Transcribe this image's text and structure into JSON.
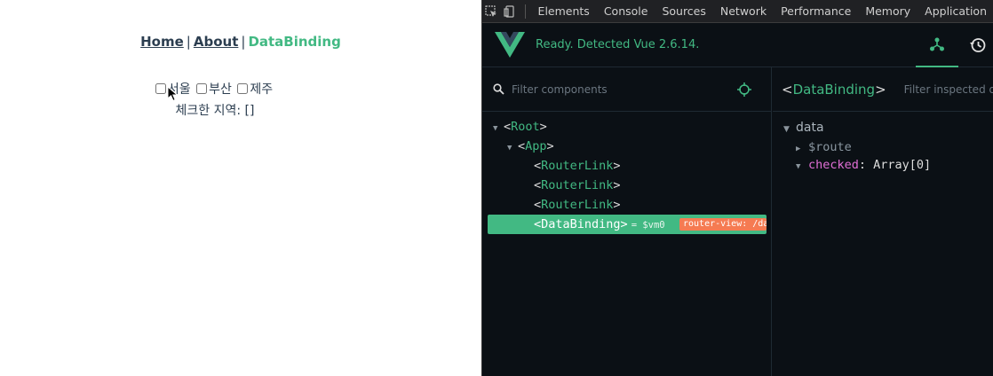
{
  "app": {
    "nav": {
      "home": "Home",
      "about": "About",
      "databinding": "DataBinding",
      "separator": "|"
    },
    "regions": [
      {
        "label": "서울",
        "checked": false
      },
      {
        "label": "부산",
        "checked": false
      },
      {
        "label": "제주",
        "checked": false
      }
    ],
    "checked_label": "체크한 지역: []"
  },
  "devtools": {
    "tabs": [
      "Elements",
      "Console",
      "Sources",
      "Network",
      "Performance",
      "Memory",
      "Application"
    ],
    "vue": {
      "status": "Ready. Detected Vue 2.6.14.",
      "accent": "#42b983",
      "filter_components_placeholder": "Filter components",
      "filter_inspected_placeholder": "Filter inspected data",
      "tree": [
        {
          "name": "Root",
          "depth": 0,
          "arrow": "▼"
        },
        {
          "name": "App",
          "depth": 1,
          "arrow": "▼"
        },
        {
          "name": "RouterLink",
          "depth": 2,
          "arrow": ""
        },
        {
          "name": "RouterLink",
          "depth": 2,
          "arrow": ""
        },
        {
          "name": "RouterLink",
          "depth": 2,
          "arrow": ""
        },
        {
          "name": "DataBinding",
          "depth": 2,
          "arrow": "",
          "selected": true,
          "vm": "= $vm0",
          "badge": "router-view: /databinding"
        }
      ],
      "inspector": {
        "component": "DataBinding",
        "section": "data",
        "rows": [
          {
            "arrow": "▶",
            "key": "$route",
            "value": ""
          },
          {
            "arrow": "▼",
            "key": "checked",
            "value": ": Array[0]"
          }
        ]
      }
    }
  }
}
